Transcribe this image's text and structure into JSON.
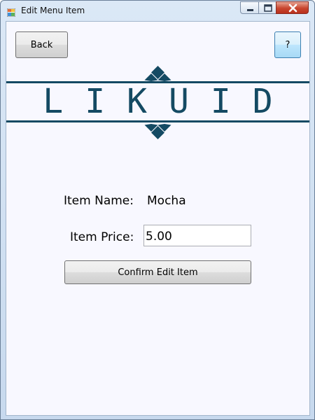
{
  "window": {
    "title": "Edit Menu Item",
    "icon": "app-window-icon",
    "controls": {
      "minimize_icon": "minimize-icon",
      "maximize_icon": "maximize-icon",
      "close_icon": "close-icon"
    }
  },
  "toolbar": {
    "back_label": "Back",
    "help_label": "?"
  },
  "logo": {
    "text": "LIKUID",
    "color": "#144a63"
  },
  "form": {
    "item_name_label": "Item Name:",
    "item_name_value": "Mocha",
    "item_price_label": "Item Price:",
    "item_price_value": "5.00",
    "confirm_label": "Confirm Edit Item"
  },
  "colors": {
    "client_background": "#f8f8ff",
    "accent": "#144a63",
    "close_button": "#c8452e"
  }
}
